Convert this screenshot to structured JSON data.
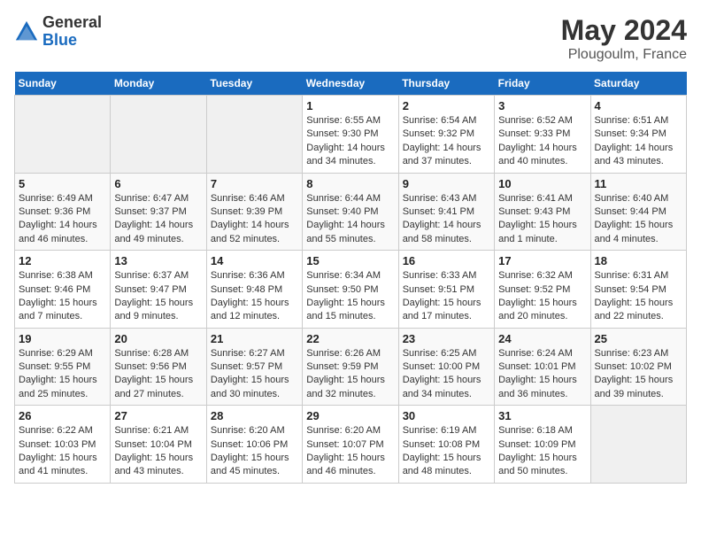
{
  "logo": {
    "line1": "General",
    "line2": "Blue"
  },
  "title": "May 2024",
  "subtitle": "Plougoulm, France",
  "days_of_week": [
    "Sunday",
    "Monday",
    "Tuesday",
    "Wednesday",
    "Thursday",
    "Friday",
    "Saturday"
  ],
  "weeks": [
    [
      {
        "day": "",
        "info": ""
      },
      {
        "day": "",
        "info": ""
      },
      {
        "day": "",
        "info": ""
      },
      {
        "day": "1",
        "info": "Sunrise: 6:55 AM\nSunset: 9:30 PM\nDaylight: 14 hours\nand 34 minutes."
      },
      {
        "day": "2",
        "info": "Sunrise: 6:54 AM\nSunset: 9:32 PM\nDaylight: 14 hours\nand 37 minutes."
      },
      {
        "day": "3",
        "info": "Sunrise: 6:52 AM\nSunset: 9:33 PM\nDaylight: 14 hours\nand 40 minutes."
      },
      {
        "day": "4",
        "info": "Sunrise: 6:51 AM\nSunset: 9:34 PM\nDaylight: 14 hours\nand 43 minutes."
      }
    ],
    [
      {
        "day": "5",
        "info": "Sunrise: 6:49 AM\nSunset: 9:36 PM\nDaylight: 14 hours\nand 46 minutes."
      },
      {
        "day": "6",
        "info": "Sunrise: 6:47 AM\nSunset: 9:37 PM\nDaylight: 14 hours\nand 49 minutes."
      },
      {
        "day": "7",
        "info": "Sunrise: 6:46 AM\nSunset: 9:39 PM\nDaylight: 14 hours\nand 52 minutes."
      },
      {
        "day": "8",
        "info": "Sunrise: 6:44 AM\nSunset: 9:40 PM\nDaylight: 14 hours\nand 55 minutes."
      },
      {
        "day": "9",
        "info": "Sunrise: 6:43 AM\nSunset: 9:41 PM\nDaylight: 14 hours\nand 58 minutes."
      },
      {
        "day": "10",
        "info": "Sunrise: 6:41 AM\nSunset: 9:43 PM\nDaylight: 15 hours\nand 1 minute."
      },
      {
        "day": "11",
        "info": "Sunrise: 6:40 AM\nSunset: 9:44 PM\nDaylight: 15 hours\nand 4 minutes."
      }
    ],
    [
      {
        "day": "12",
        "info": "Sunrise: 6:38 AM\nSunset: 9:46 PM\nDaylight: 15 hours\nand 7 minutes."
      },
      {
        "day": "13",
        "info": "Sunrise: 6:37 AM\nSunset: 9:47 PM\nDaylight: 15 hours\nand 9 minutes."
      },
      {
        "day": "14",
        "info": "Sunrise: 6:36 AM\nSunset: 9:48 PM\nDaylight: 15 hours\nand 12 minutes."
      },
      {
        "day": "15",
        "info": "Sunrise: 6:34 AM\nSunset: 9:50 PM\nDaylight: 15 hours\nand 15 minutes."
      },
      {
        "day": "16",
        "info": "Sunrise: 6:33 AM\nSunset: 9:51 PM\nDaylight: 15 hours\nand 17 minutes."
      },
      {
        "day": "17",
        "info": "Sunrise: 6:32 AM\nSunset: 9:52 PM\nDaylight: 15 hours\nand 20 minutes."
      },
      {
        "day": "18",
        "info": "Sunrise: 6:31 AM\nSunset: 9:54 PM\nDaylight: 15 hours\nand 22 minutes."
      }
    ],
    [
      {
        "day": "19",
        "info": "Sunrise: 6:29 AM\nSunset: 9:55 PM\nDaylight: 15 hours\nand 25 minutes."
      },
      {
        "day": "20",
        "info": "Sunrise: 6:28 AM\nSunset: 9:56 PM\nDaylight: 15 hours\nand 27 minutes."
      },
      {
        "day": "21",
        "info": "Sunrise: 6:27 AM\nSunset: 9:57 PM\nDaylight: 15 hours\nand 30 minutes."
      },
      {
        "day": "22",
        "info": "Sunrise: 6:26 AM\nSunset: 9:59 PM\nDaylight: 15 hours\nand 32 minutes."
      },
      {
        "day": "23",
        "info": "Sunrise: 6:25 AM\nSunset: 10:00 PM\nDaylight: 15 hours\nand 34 minutes."
      },
      {
        "day": "24",
        "info": "Sunrise: 6:24 AM\nSunset: 10:01 PM\nDaylight: 15 hours\nand 36 minutes."
      },
      {
        "day": "25",
        "info": "Sunrise: 6:23 AM\nSunset: 10:02 PM\nDaylight: 15 hours\nand 39 minutes."
      }
    ],
    [
      {
        "day": "26",
        "info": "Sunrise: 6:22 AM\nSunset: 10:03 PM\nDaylight: 15 hours\nand 41 minutes."
      },
      {
        "day": "27",
        "info": "Sunrise: 6:21 AM\nSunset: 10:04 PM\nDaylight: 15 hours\nand 43 minutes."
      },
      {
        "day": "28",
        "info": "Sunrise: 6:20 AM\nSunset: 10:06 PM\nDaylight: 15 hours\nand 45 minutes."
      },
      {
        "day": "29",
        "info": "Sunrise: 6:20 AM\nSunset: 10:07 PM\nDaylight: 15 hours\nand 46 minutes."
      },
      {
        "day": "30",
        "info": "Sunrise: 6:19 AM\nSunset: 10:08 PM\nDaylight: 15 hours\nand 48 minutes."
      },
      {
        "day": "31",
        "info": "Sunrise: 6:18 AM\nSunset: 10:09 PM\nDaylight: 15 hours\nand 50 minutes."
      },
      {
        "day": "",
        "info": ""
      }
    ]
  ]
}
